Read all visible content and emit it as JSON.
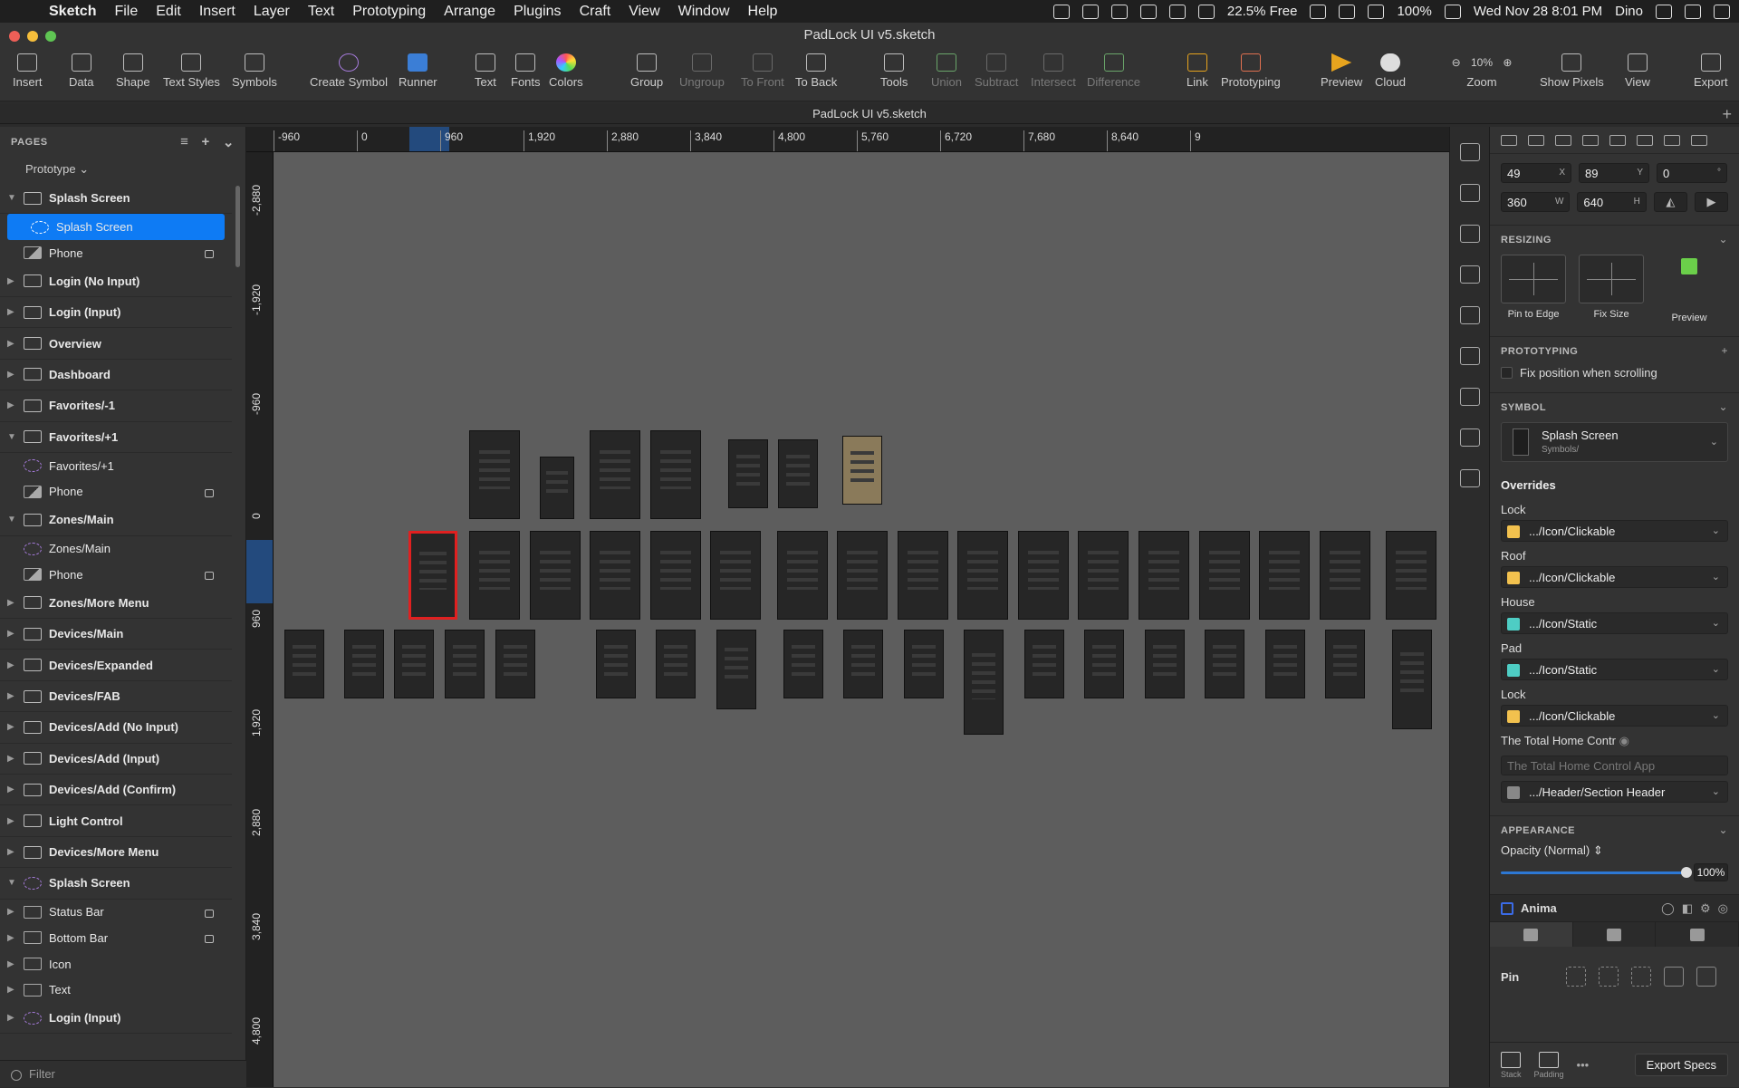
{
  "menubar": {
    "app_name": "Sketch",
    "items": [
      "File",
      "Edit",
      "Insert",
      "Layer",
      "Text",
      "Prototyping",
      "Arrange",
      "Plugins",
      "Craft",
      "View",
      "Window",
      "Help"
    ],
    "status": {
      "memory": "22.5% Free",
      "battery": "100%",
      "datetime": "Wed Nov 28  8:01 PM",
      "user": "Dino"
    }
  },
  "window": {
    "document_title": "PadLock UI v5.sketch",
    "tab_title": "PadLock UI v5.sketch"
  },
  "toolbar": {
    "insert": "Insert",
    "data": "Data",
    "shape": "Shape",
    "text_styles": "Text Styles",
    "symbols": "Symbols",
    "create_symbol": "Create Symbol",
    "runner": "Runner",
    "text": "Text",
    "fonts": "Fonts",
    "colors": "Colors",
    "group": "Group",
    "ungroup": "Ungroup",
    "to_front": "To Front",
    "to_back": "To Back",
    "tools": "Tools",
    "union": "Union",
    "subtract": "Subtract",
    "intersect": "Intersect",
    "difference": "Difference",
    "link": "Link",
    "prototyping": "Prototyping",
    "preview": "Preview",
    "cloud": "Cloud",
    "zoom_label": "Zoom",
    "zoom_value": "10%",
    "show_pixels": "Show Pixels",
    "view": "View",
    "export": "Export"
  },
  "sidebar": {
    "header": "PAGES",
    "current_page": "Prototype",
    "filter_placeholder": "Filter",
    "layers": [
      {
        "name": "Splash Screen",
        "type": "artboard",
        "expanded": true
      },
      {
        "name": "Splash Screen",
        "type": "symbol",
        "child": true,
        "selected": true
      },
      {
        "name": "Phone",
        "type": "image",
        "child": true,
        "locked": true
      },
      {
        "name": "Login (No Input)",
        "type": "artboard"
      },
      {
        "name": "Login (Input)",
        "type": "artboard"
      },
      {
        "name": "Overview",
        "type": "artboard"
      },
      {
        "name": "Dashboard",
        "type": "artboard"
      },
      {
        "name": "Favorites/-1",
        "type": "artboard"
      },
      {
        "name": "Favorites/+1",
        "type": "artboard",
        "expanded": true
      },
      {
        "name": "Favorites/+1",
        "type": "symbol",
        "child": true
      },
      {
        "name": "Phone",
        "type": "image",
        "child": true,
        "locked": true
      },
      {
        "name": "Zones/Main",
        "type": "artboard",
        "expanded": true
      },
      {
        "name": "Zones/Main",
        "type": "symbol",
        "child": true
      },
      {
        "name": "Phone",
        "type": "image",
        "child": true,
        "locked": true
      },
      {
        "name": "Zones/More Menu",
        "type": "artboard"
      },
      {
        "name": "Devices/Main",
        "type": "artboard"
      },
      {
        "name": "Devices/Expanded",
        "type": "artboard"
      },
      {
        "name": "Devices/FAB",
        "type": "artboard"
      },
      {
        "name": "Devices/Add (No Input)",
        "type": "artboard"
      },
      {
        "name": "Devices/Add (Input)",
        "type": "artboard"
      },
      {
        "name": "Devices/Add (Confirm)",
        "type": "artboard"
      },
      {
        "name": "Light Control",
        "type": "artboard"
      },
      {
        "name": "Devices/More Menu",
        "type": "artboard"
      },
      {
        "name": "Splash Screen",
        "type": "symbol-master",
        "expanded": true
      },
      {
        "name": "Status Bar",
        "type": "folder",
        "child": true,
        "locked": true
      },
      {
        "name": "Bottom Bar",
        "type": "folder",
        "child": true,
        "locked": true
      },
      {
        "name": "Icon",
        "type": "folder",
        "child": true
      },
      {
        "name": "Text",
        "type": "folder",
        "child": true
      },
      {
        "name": "Login (Input)",
        "type": "symbol-master"
      }
    ]
  },
  "rulers": {
    "top": [
      "-960",
      "0",
      "960",
      "1,920",
      "2,880",
      "3,840",
      "4,800",
      "5,760",
      "6,720",
      "7,680",
      "8,640",
      "9"
    ],
    "left": [
      "-2,880",
      "-1,920",
      "-960",
      "0",
      "960",
      "1,920",
      "2,880",
      "3,840",
      "4,800"
    ]
  },
  "inspector": {
    "x": "49",
    "x_label": "X",
    "y": "89",
    "y_label": "Y",
    "rotation": "0",
    "rotation_unit": "°",
    "w": "360",
    "w_label": "W",
    "h": "640",
    "h_label": "H",
    "resizing_title": "RESIZING",
    "pin_to_edge": "Pin to Edge",
    "fix_size": "Fix Size",
    "preview": "Preview",
    "prototyping_title": "PROTOTYPING",
    "fix_position": "Fix position when scrolling",
    "symbol_title": "SYMBOL",
    "symbol_name": "Splash Screen",
    "symbol_path": "Symbols/",
    "overrides_title": "Overrides",
    "overrides": [
      {
        "label": "Lock",
        "value": ".../Icon/Clickable",
        "color": "#f2c14e"
      },
      {
        "label": "Roof",
        "value": ".../Icon/Clickable",
        "color": "#f2c14e"
      },
      {
        "label": "House",
        "value": ".../Icon/Static",
        "color": "#4ecdc4"
      },
      {
        "label": "Pad",
        "value": ".../Icon/Static",
        "color": "#4ecdc4"
      },
      {
        "label": "Lock",
        "value": ".../Icon/Clickable",
        "color": "#f2c14e"
      }
    ],
    "text_override_label": "The Total Home Contr",
    "text_override_placeholder": "The Total Home Control App",
    "text_style_value": ".../Header/Section Header",
    "appearance_title": "APPEARANCE",
    "opacity_label": "Opacity (Normal)",
    "opacity_value": "100%",
    "anima_label": "Anima",
    "pin_label": "Pin",
    "stack_label": "Stack",
    "padding_label": "Padding",
    "export_specs": "Export Specs"
  }
}
